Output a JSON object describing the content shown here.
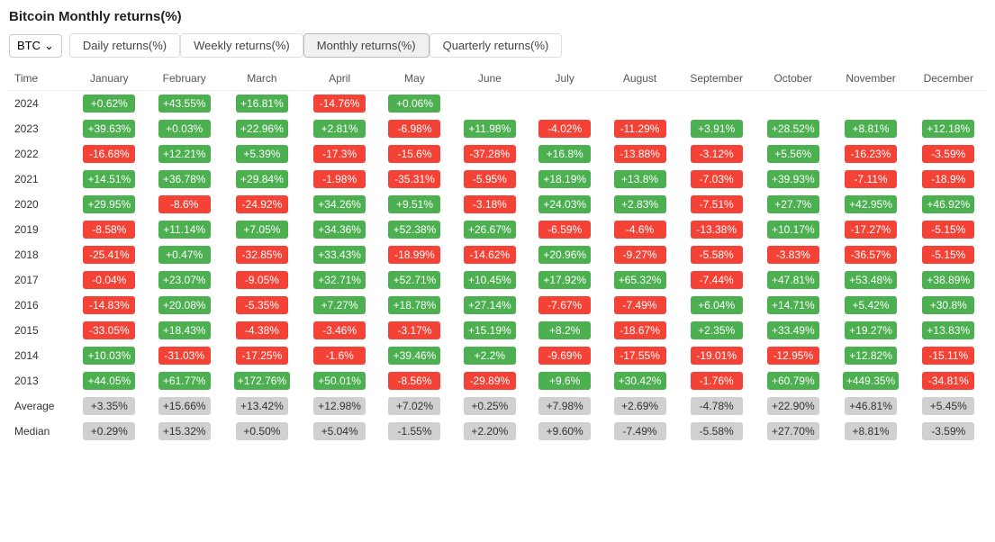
{
  "title": "Bitcoin Monthly returns(%)",
  "toolbar": {
    "asset": "BTC",
    "tabs": [
      {
        "label": "Daily returns(%)",
        "active": false
      },
      {
        "label": "Weekly returns(%)",
        "active": false
      },
      {
        "label": "Monthly returns(%)",
        "active": true
      },
      {
        "label": "Quarterly returns(%)",
        "active": false
      }
    ]
  },
  "columns": [
    "Time",
    "January",
    "February",
    "March",
    "April",
    "May",
    "June",
    "July",
    "August",
    "September",
    "October",
    "November",
    "December"
  ],
  "rows": [
    {
      "year": "2024",
      "values": [
        "+0.62%",
        "+43.55%",
        "+16.81%",
        "-14.76%",
        "+0.06%",
        null,
        null,
        null,
        null,
        null,
        null,
        null
      ]
    },
    {
      "year": "2023",
      "values": [
        "+39.63%",
        "+0.03%",
        "+22.96%",
        "+2.81%",
        "-6.98%",
        "+11.98%",
        "-4.02%",
        "-11.29%",
        "+3.91%",
        "+28.52%",
        "+8.81%",
        "+12.18%"
      ]
    },
    {
      "year": "2022",
      "values": [
        "-16.68%",
        "+12.21%",
        "+5.39%",
        "-17.3%",
        "-15.6%",
        "-37.28%",
        "+16.8%",
        "-13.88%",
        "-3.12%",
        "+5.56%",
        "-16.23%",
        "-3.59%"
      ]
    },
    {
      "year": "2021",
      "values": [
        "+14.51%",
        "+36.78%",
        "+29.84%",
        "-1.98%",
        "-35.31%",
        "-5.95%",
        "+18.19%",
        "+13.8%",
        "-7.03%",
        "+39.93%",
        "-7.11%",
        "-18.9%"
      ]
    },
    {
      "year": "2020",
      "values": [
        "+29.95%",
        "-8.6%",
        "-24.92%",
        "+34.26%",
        "+9.51%",
        "-3.18%",
        "+24.03%",
        "+2.83%",
        "-7.51%",
        "+27.7%",
        "+42.95%",
        "+46.92%"
      ]
    },
    {
      "year": "2019",
      "values": [
        "-8.58%",
        "+11.14%",
        "+7.05%",
        "+34.36%",
        "+52.38%",
        "+26.67%",
        "-6.59%",
        "-4.6%",
        "-13.38%",
        "+10.17%",
        "-17.27%",
        "-5.15%"
      ]
    },
    {
      "year": "2018",
      "values": [
        "-25.41%",
        "+0.47%",
        "-32.85%",
        "+33.43%",
        "-18.99%",
        "-14.62%",
        "+20.96%",
        "-9.27%",
        "-5.58%",
        "-3.83%",
        "-36.57%",
        "-5.15%"
      ]
    },
    {
      "year": "2017",
      "values": [
        "-0.04%",
        "+23.07%",
        "-9.05%",
        "+32.71%",
        "+52.71%",
        "+10.45%",
        "+17.92%",
        "+65.32%",
        "-7.44%",
        "+47.81%",
        "+53.48%",
        "+38.89%"
      ]
    },
    {
      "year": "2016",
      "values": [
        "-14.83%",
        "+20.08%",
        "-5.35%",
        "+7.27%",
        "+18.78%",
        "+27.14%",
        "-7.67%",
        "-7.49%",
        "+6.04%",
        "+14.71%",
        "+5.42%",
        "+30.8%"
      ]
    },
    {
      "year": "2015",
      "values": [
        "-33.05%",
        "+18.43%",
        "-4.38%",
        "-3.46%",
        "-3.17%",
        "+15.19%",
        "+8.2%",
        "-18.67%",
        "+2.35%",
        "+33.49%",
        "+19.27%",
        "+13.83%"
      ]
    },
    {
      "year": "2014",
      "values": [
        "+10.03%",
        "-31.03%",
        "-17.25%",
        "-1.6%",
        "+39.46%",
        "+2.2%",
        "-9.69%",
        "-17.55%",
        "-19.01%",
        "-12.95%",
        "+12.82%",
        "-15.11%"
      ]
    },
    {
      "year": "2013",
      "values": [
        "+44.05%",
        "+61.77%",
        "+172.76%",
        "+50.01%",
        "-8.56%",
        "-29.89%",
        "+9.6%",
        "+30.42%",
        "-1.76%",
        "+60.79%",
        "+449.35%",
        "-34.81%"
      ]
    }
  ],
  "average": {
    "label": "Average",
    "values": [
      "+3.35%",
      "+15.66%",
      "+13.42%",
      "+12.98%",
      "+7.02%",
      "+0.25%",
      "+7.98%",
      "+2.69%",
      "-4.78%",
      "+22.90%",
      "+46.81%",
      "+5.45%"
    ]
  },
  "median": {
    "label": "Median",
    "values": [
      "+0.29%",
      "+15.32%",
      "+0.50%",
      "+5.04%",
      "-1.55%",
      "+2.20%",
      "+9.60%",
      "-7.49%",
      "-5.58%",
      "+27.70%",
      "+8.81%",
      "-3.59%"
    ]
  }
}
